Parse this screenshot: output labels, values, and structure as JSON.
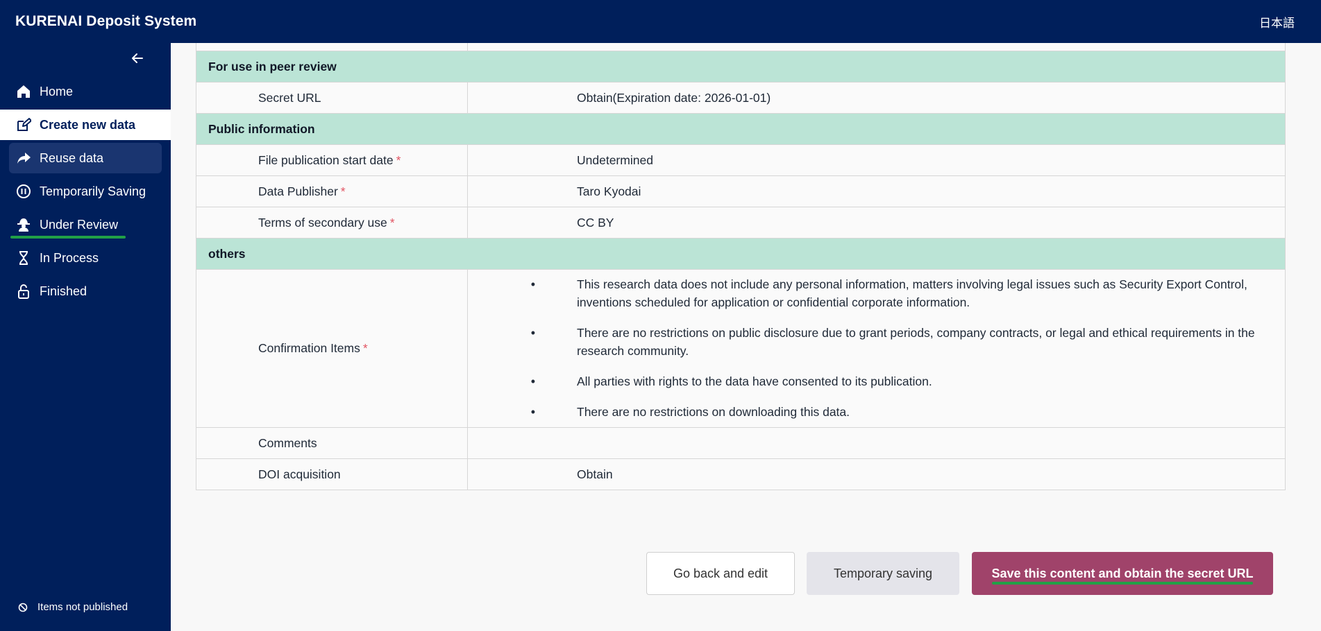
{
  "header": {
    "title": "KURENAI Deposit System",
    "language": "日本語"
  },
  "sidebar": {
    "items": [
      {
        "label": "Home",
        "icon": "home-icon"
      },
      {
        "label": "Create new data",
        "icon": "edit-icon"
      },
      {
        "label": "Reuse data",
        "icon": "share-arrow-icon"
      },
      {
        "label": "Temporarily Saving",
        "icon": "pause-icon"
      },
      {
        "label": "Under Review",
        "icon": "detective-icon"
      },
      {
        "label": "In Process",
        "icon": "hourglass-icon"
      },
      {
        "label": "Finished",
        "icon": "unlock-icon"
      }
    ],
    "footer": "Items not published"
  },
  "table": {
    "sections": {
      "peer_review": "For use in peer review",
      "public_info": "Public information",
      "others": "others"
    },
    "rows": {
      "secret_url": {
        "label": "Secret URL",
        "value": "Obtain(Expiration date: 2026-01-01)"
      },
      "pub_start": {
        "label": "File publication start date",
        "value": "Undetermined",
        "required": "*"
      },
      "publisher": {
        "label": "Data Publisher",
        "value": "Taro Kyodai",
        "required": "*"
      },
      "terms": {
        "label": "Terms of secondary use",
        "value": "CC BY",
        "required": "*"
      },
      "confirm": {
        "label": "Confirmation Items",
        "required": "*",
        "bullet": "•",
        "items": [
          "This research data does not include any personal information, matters involving legal issues such as Security Export Control, inventions scheduled for application or confidential corporate information.",
          "There are no restrictions on public disclosure due to grant periods, company contracts, or legal and ethical requirements in the research community.",
          "All parties with rights to the data have consented to its publication.",
          "There are no restrictions on downloading this data."
        ]
      },
      "comments": {
        "label": "Comments",
        "value": ""
      },
      "doi": {
        "label": "DOI acquisition",
        "value": "Obtain"
      }
    }
  },
  "buttons": {
    "back": "Go back and edit",
    "temp": "Temporary saving",
    "save": "Save this content and obtain the secret URL"
  },
  "colors": {
    "navy": "#001f5b",
    "section_bg": "#bbe4d6",
    "primary_button": "#a0436a",
    "highlight_underline": "#21a047",
    "required": "#e25563"
  }
}
